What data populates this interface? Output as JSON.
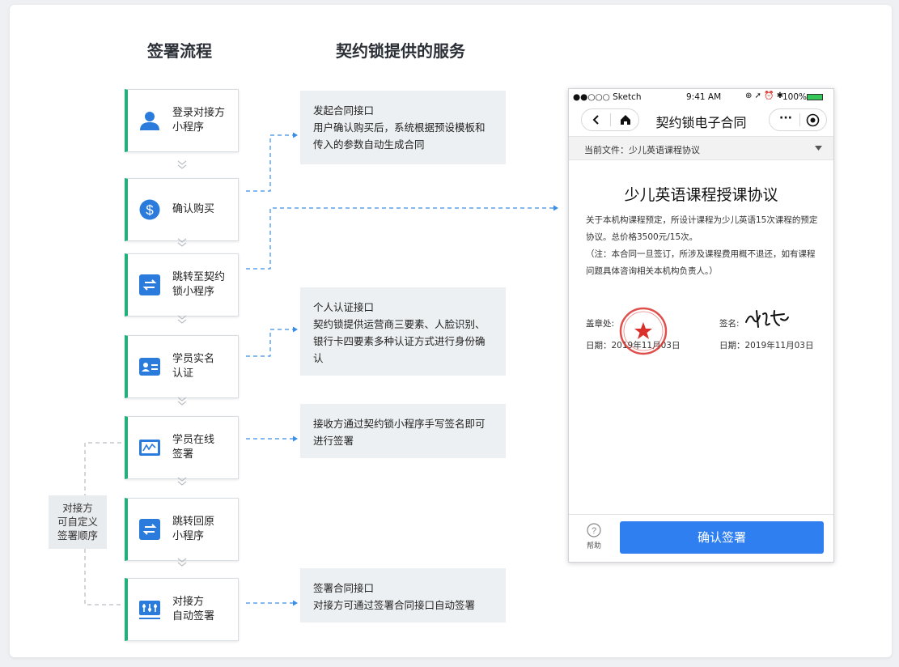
{
  "headings": {
    "flow": "签署流程",
    "services": "契约锁提供的服务"
  },
  "steps": [
    {
      "label": "登录对接方\n小程序",
      "icon": "user-icon"
    },
    {
      "label": "确认购买",
      "icon": "dollar-icon"
    },
    {
      "label": "跳转至契约\n锁小程序",
      "icon": "switch-icon"
    },
    {
      "label": "学员实名\n认证",
      "icon": "id-card-icon"
    },
    {
      "label": "学员在线\n签署",
      "icon": "sign-icon"
    },
    {
      "label": "跳转回原\n小程序",
      "icon": "switch-icon"
    },
    {
      "label": "对接方\n自动签署",
      "icon": "auto-sign-icon"
    }
  ],
  "services": [
    {
      "title": "发起合同接口",
      "body": "用户确认购买后，系统根据预设模板和\n传入的参数自动生成合同"
    },
    {
      "title": "个人认证接口",
      "body": "契约锁提供运营商三要素、人脸识别、\n银行卡四要素多种认证方式进行身份确\n认"
    },
    {
      "title": "",
      "body": "接收方通过契约锁小程序手写签名即可\n进行签署"
    },
    {
      "title": "签署合同接口",
      "body": "对接方可通过签署合同接口自动签署"
    }
  ],
  "note": "对接方\n可自定义\n签署顺序",
  "phone": {
    "status": {
      "carrier": "●●○○○ Sketch",
      "time": "9:41 AM",
      "battery": "100%"
    },
    "nav_title": "契约锁电子合同",
    "file_label": "当前文件：少儿英语课程协议",
    "doc_title": "少儿英语课程授课协议",
    "doc_para1": "关于本机构课程预定，所设计课程为少儿英语15次课程的预定协议。总价格3500元/15次。",
    "doc_para2": "（注：本合同一旦签订，所涉及课程费用概不退还，如有课程问题具体咨询相关本机构负责人。）",
    "stamp_label": "盖章处:",
    "sign_label": "签名:",
    "date_left": "日期：2019年11月03日",
    "date_right": "日期：2019年11月03日",
    "help_label": "帮助",
    "confirm_label": "确认签署"
  },
  "colors": {
    "accent_green": "#22b07a",
    "icon_blue": "#2a7bdc",
    "arrow_blue": "#3a8ee6",
    "button_blue": "#2f7ff0"
  }
}
